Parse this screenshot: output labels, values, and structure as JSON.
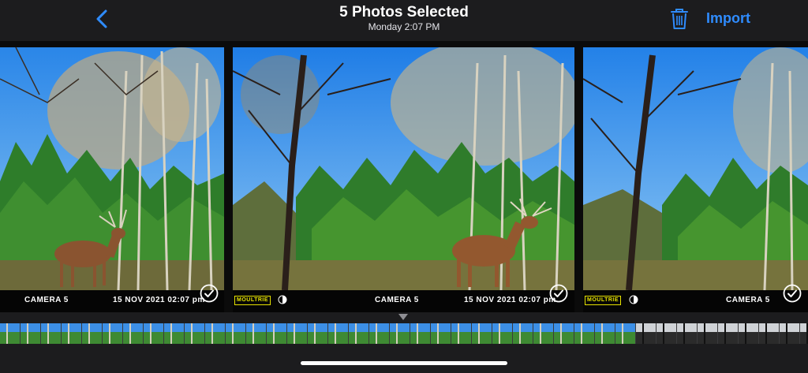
{
  "header": {
    "title": "5 Photos Selected",
    "subtitle": "Monday  2:07 PM",
    "import_label": "Import",
    "back_icon": "chevron-left-icon",
    "trash_icon": "trash-icon"
  },
  "colors": {
    "accent": "#2f8cff",
    "background": "#1c1c1e",
    "brand_yellow": "#e7e300"
  },
  "photos": [
    {
      "camera": "CAMERA 5",
      "datetime": "15 NOV 2021  02:07 pm",
      "selected": true
    },
    {
      "brand": "MOULTRIE",
      "camera": "CAMERA 5",
      "datetime": "15 NOV 2021  02:07 pm",
      "selected": true
    },
    {
      "brand": "MOULTRIE",
      "camera": "CAMERA 5",
      "selected": true
    }
  ]
}
